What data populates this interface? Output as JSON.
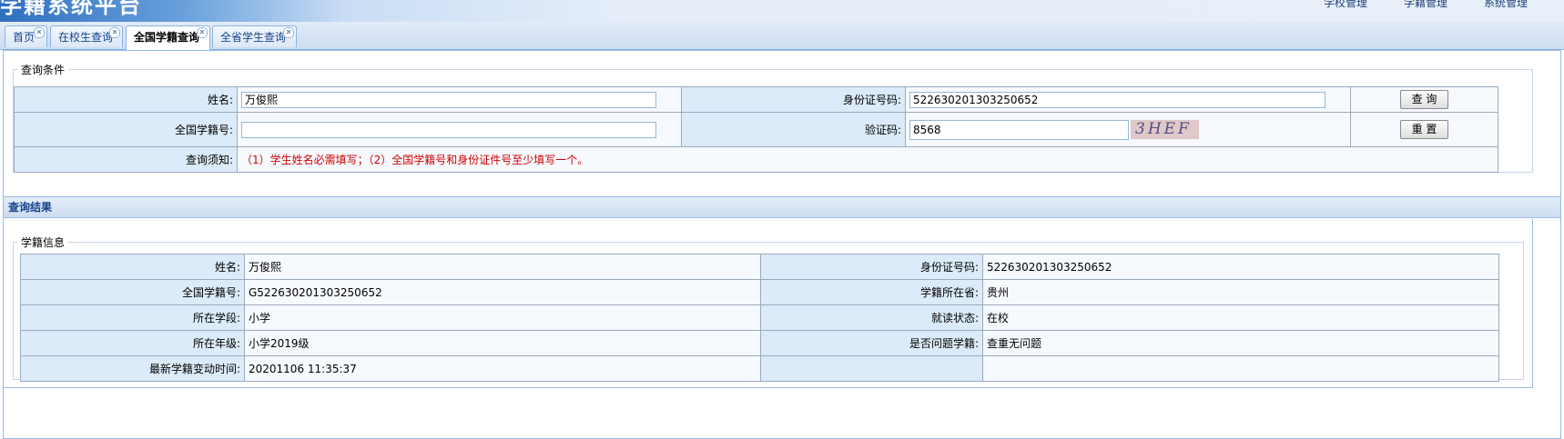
{
  "header": {
    "brand": "学籍系统平台",
    "nav": [
      "学校管理",
      "学籍管理",
      "系统管理"
    ]
  },
  "tabs": [
    {
      "label": "首页"
    },
    {
      "label": "在校生查询"
    },
    {
      "label": "全国学籍查询"
    },
    {
      "label": "全省学生查询"
    }
  ],
  "active_tab": "全国学籍查询",
  "query": {
    "legend": "查询条件",
    "name_label": "姓名:",
    "name_value": "万俊熙",
    "id_label": "身份证号码:",
    "id_value": "522630201303250652",
    "query_button": "查 询",
    "national_id_label": "全国学籍号:",
    "national_id_value": "",
    "captcha_label": "验证码:",
    "captcha_value": "8568",
    "captcha_image_text": "3HEF",
    "reset_button": "重 置",
    "notice_label": "查询须知:",
    "notice_text": "（1）学生姓名必需填写；（2）全国学籍号和身份证件号至少填写一个。"
  },
  "result": {
    "header": "查询结果",
    "legend": "学籍信息",
    "rows": [
      {
        "l1": "姓名:",
        "v1": "万俊熙",
        "l2": "身份证号码:",
        "v2": "522630201303250652"
      },
      {
        "l1": "全国学籍号:",
        "v1": "G522630201303250652",
        "l2": "学籍所在省:",
        "v2": "贵州"
      },
      {
        "l1": "所在学段:",
        "v1": "小学",
        "l2": "就读状态:",
        "v2": "在校"
      },
      {
        "l1": "所在年级:",
        "v1": "小学2019级",
        "l2": "是否问题学籍:",
        "v2": "查重无问题"
      },
      {
        "l1": "最新学籍变动时间:",
        "v1": "20201106 11:35:37",
        "l2": "",
        "v2": ""
      }
    ]
  },
  "colors": {
    "label_bg": "#dcebf9",
    "value_bg": "#f6f9fe",
    "notice_text": "#d00000",
    "header_text": "#15428b"
  }
}
